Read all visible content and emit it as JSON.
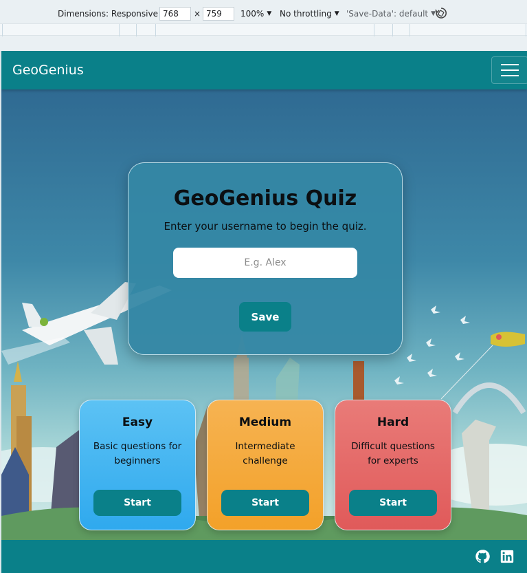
{
  "devtools": {
    "dimensions_label": "Dimensions: Responsive",
    "width_value": "768",
    "times": "×",
    "height_value": "759",
    "zoom": "100%",
    "throttling": "No throttling",
    "save_data": "'Save-Data': default"
  },
  "navbar": {
    "brand": "GeoGenius"
  },
  "quiz": {
    "title": "GeoGenius Quiz",
    "prompt": "Enter your username to begin the quiz.",
    "username_placeholder": "E.g. Alex",
    "username_value": "",
    "save_label": "Save"
  },
  "levels": [
    {
      "title": "Easy",
      "description": "Basic questions for beginners",
      "button": "Start",
      "color": "#3bb3f0"
    },
    {
      "title": "Medium",
      "description": "Intermediate challenge",
      "button": "Start",
      "color": "#f4a832"
    },
    {
      "title": "Hard",
      "description": "Difficult questions for experts",
      "button": "Start",
      "color": "#e26463"
    }
  ],
  "footer": {
    "icons": [
      "github-icon",
      "linkedin-icon"
    ]
  },
  "colors": {
    "primary": "#0a8089",
    "panel": "#3487a5"
  }
}
